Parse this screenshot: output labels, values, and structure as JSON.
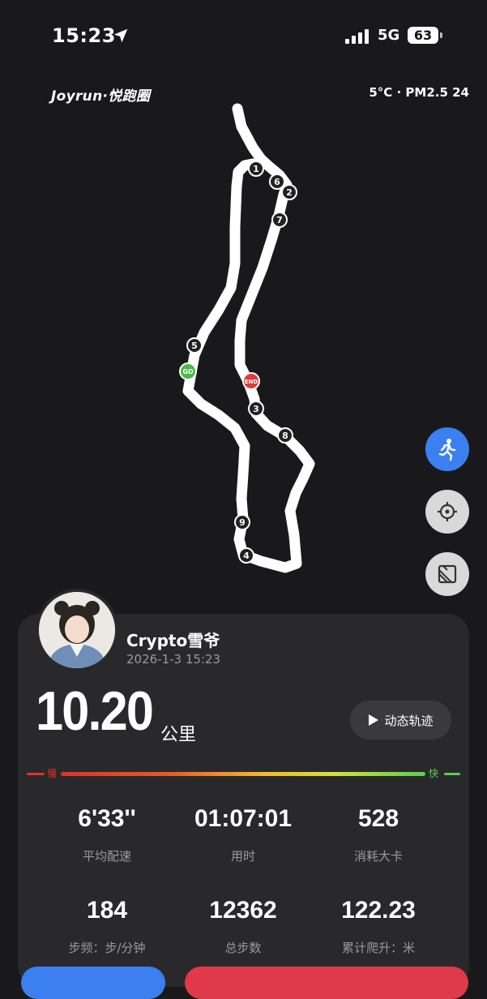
{
  "status_bar": {
    "time": "15:23",
    "network": "5G",
    "battery": "63"
  },
  "header": {
    "brand": "Joyrun·悦跑圈",
    "weather": "5°C · PM2.5 24"
  },
  "map": {
    "start_label": "GO",
    "end_label": "END",
    "km_markers": [
      "1",
      "2",
      "3",
      "4",
      "5",
      "6",
      "7",
      "8",
      "9"
    ]
  },
  "user": {
    "name": "Crypto雪爷",
    "datetime": "2026-1-3 15:23"
  },
  "run": {
    "distance": "10.20",
    "distance_unit": "公里",
    "replay_label": "动态轨迹",
    "slow_label": "慢",
    "fast_label": "快",
    "stats": [
      {
        "value": "6'33''",
        "label": "平均配速"
      },
      {
        "value": "01:07:01",
        "label": "用时"
      },
      {
        "value": "528",
        "label": "消耗大卡"
      },
      {
        "value": "184",
        "label": "步频：步/分钟"
      },
      {
        "value": "12362",
        "label": "总步数"
      },
      {
        "value": "122.23",
        "label": "累计爬升：米"
      }
    ]
  },
  "colors": {
    "background": "#19191b",
    "card": "#29292c",
    "accent": "#3b7ff0",
    "start": "#4cb84a",
    "end": "#e03a3a"
  }
}
